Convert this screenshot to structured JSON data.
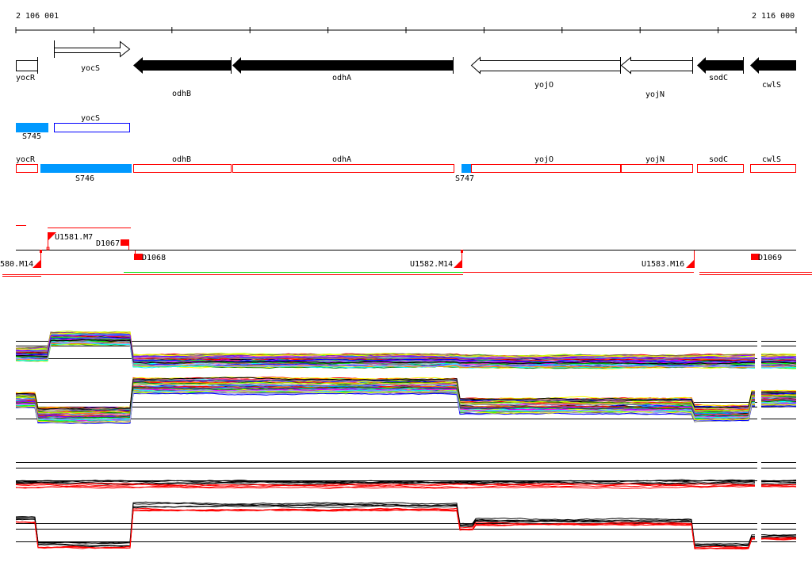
{
  "ruler": {
    "start_label": "2 106 001",
    "end_label": "2 116 000"
  },
  "genes": [
    {
      "name": "yocR",
      "strand": "none",
      "fill": "white"
    },
    {
      "name": "yocS",
      "strand": "+",
      "fill": "white"
    },
    {
      "name": "odhB",
      "strand": "-",
      "fill": "black"
    },
    {
      "name": "odhA",
      "strand": "-",
      "fill": "black"
    },
    {
      "name": "yojO",
      "strand": "-",
      "fill": "white"
    },
    {
      "name": "yojN",
      "strand": "-",
      "fill": "white"
    },
    {
      "name": "sodC",
      "strand": "-",
      "fill": "black"
    },
    {
      "name": "cwlS",
      "strand": "-",
      "fill": "black"
    }
  ],
  "track_upper": {
    "segments": [
      {
        "label": "S745"
      },
      {
        "label": "yocS"
      }
    ]
  },
  "track_lower": {
    "segments": [
      {
        "label": "yocR"
      },
      {
        "label": "S746"
      },
      {
        "label": "odhB"
      },
      {
        "label": "odhA"
      },
      {
        "label": "S747"
      },
      {
        "label": "yojO"
      },
      {
        "label": "yojN"
      },
      {
        "label": "sodC"
      },
      {
        "label": "cwlS"
      }
    ]
  },
  "features": {
    "u1580": "580.M14",
    "u1581": "U1581.M7",
    "d1067": "D1067",
    "d1068": "D1068",
    "u1582": "U1582.M14",
    "u1583": "U1583.M16",
    "d1069": "D1069"
  },
  "colors": {
    "blue_segment": "#0099ff",
    "blue_outline": "#0000ff",
    "red": "#ff0000",
    "green": "#00dd00",
    "trace_palette": [
      "#ff0000",
      "#00ff00",
      "#0000ff",
      "#ff00ff",
      "#00ffff",
      "#ffff00",
      "#ff8000",
      "#808080",
      "#8000ff",
      "#008000",
      "#000000",
      "#a0a0ff",
      "#ff80c0",
      "#806040",
      "#00a0ff",
      "#c0ff00"
    ]
  }
}
